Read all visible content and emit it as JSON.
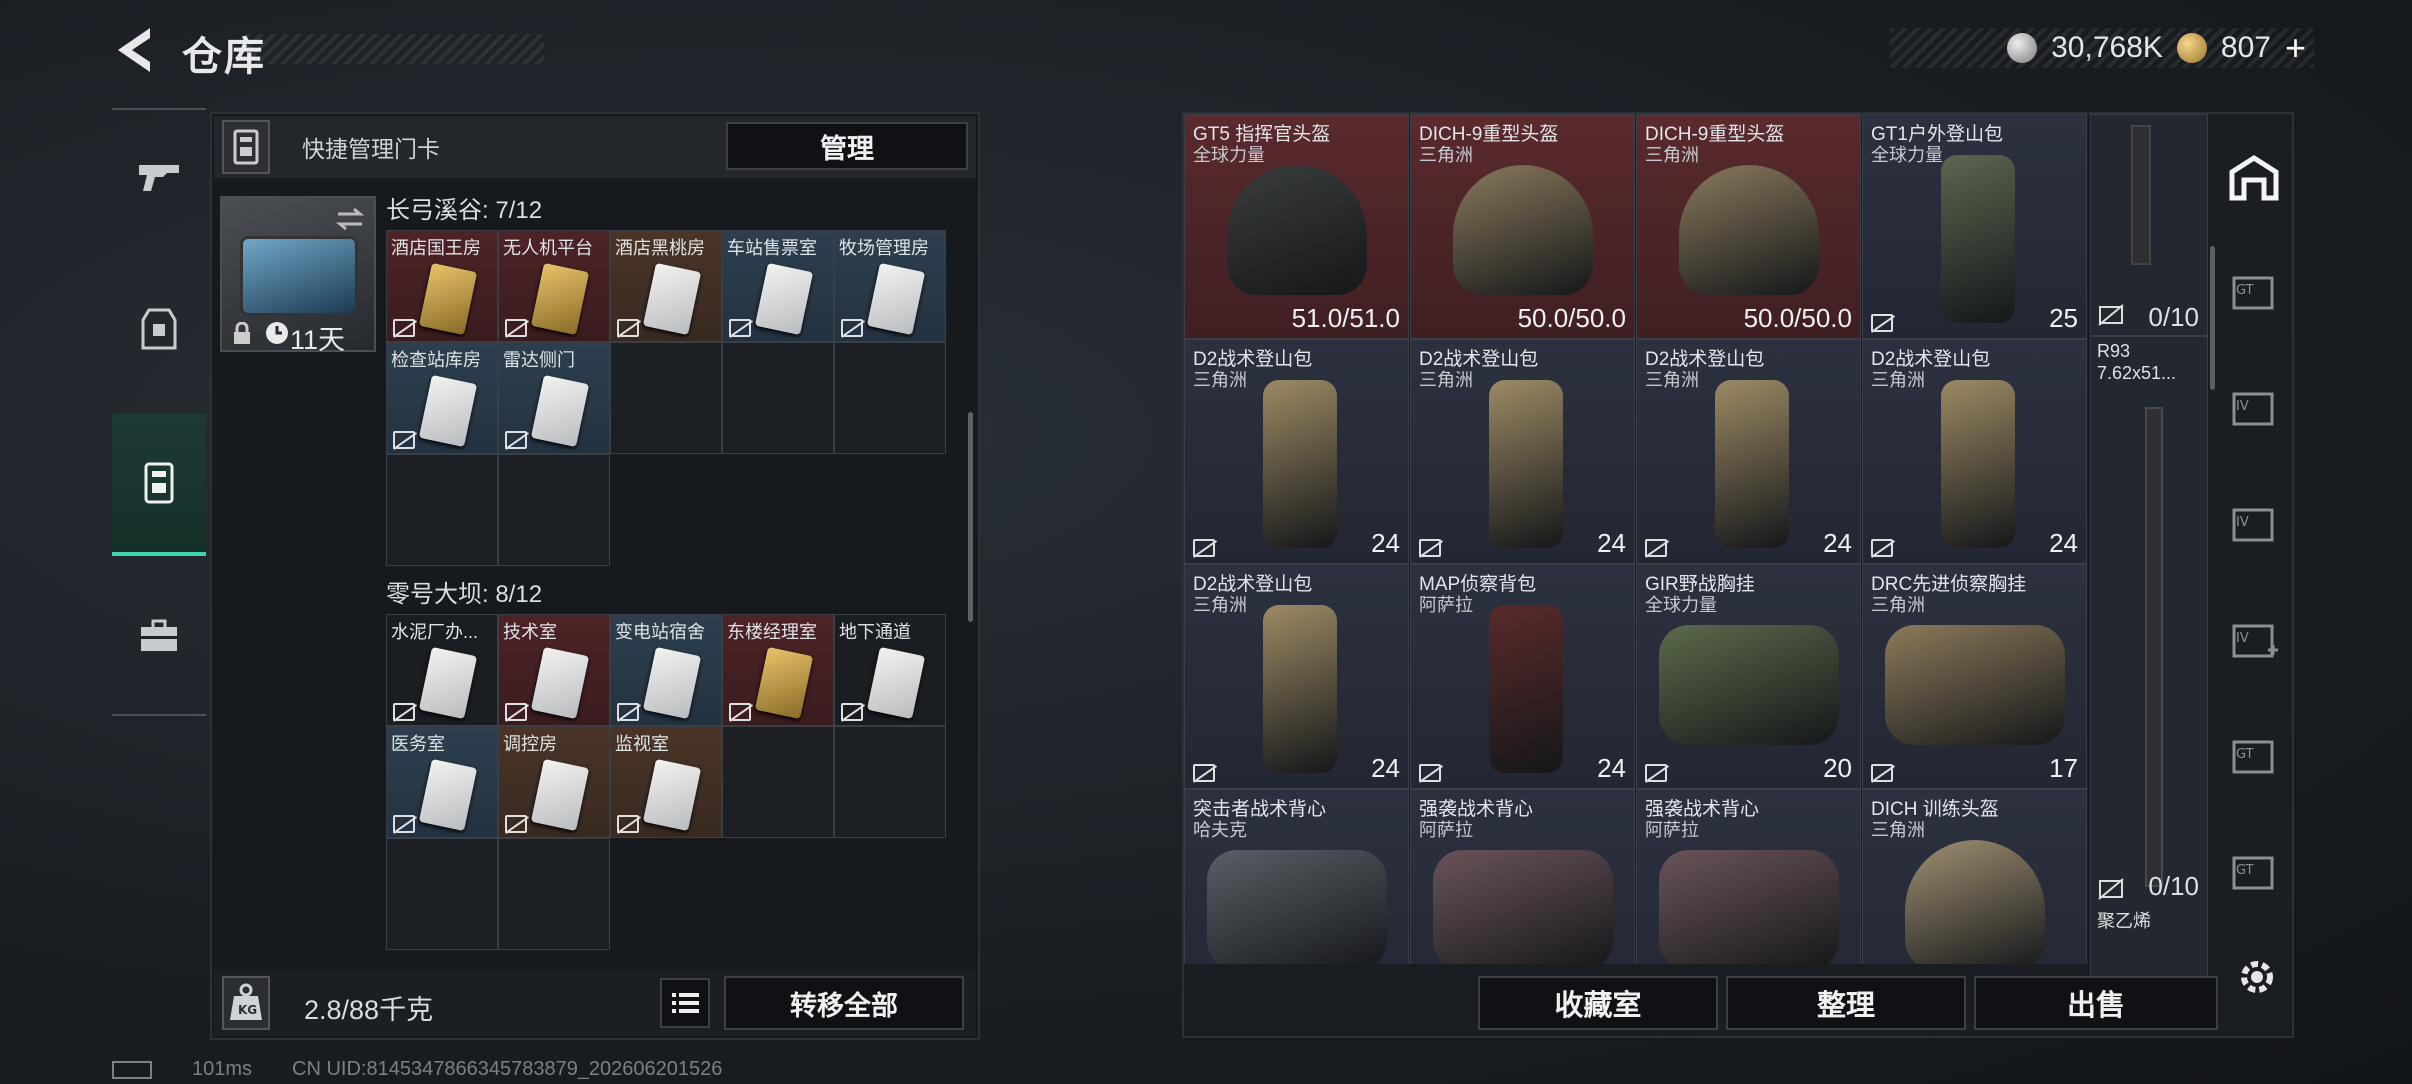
{
  "header": {
    "title": "仓库"
  },
  "currency": {
    "coins": "30,768K",
    "tokens": "807",
    "plus": "+"
  },
  "card_panel": {
    "header_label": "快捷管理门卡",
    "manage_label": "管理",
    "holder_days": "11天",
    "sections": [
      {
        "title": "长弓溪谷: 7/12",
        "cards": [
          {
            "label": "酒店国王房",
            "tone": "red",
            "card": "gold"
          },
          {
            "label": "无人机平台",
            "tone": "red",
            "card": "gold"
          },
          {
            "label": "酒店黑桃房",
            "tone": "brown",
            "card": "white"
          },
          {
            "label": "车站售票室",
            "tone": "blue",
            "card": "white"
          },
          {
            "label": "牧场管理房",
            "tone": "blue",
            "card": "white"
          },
          {
            "label": "检查站库房",
            "tone": "blue",
            "card": "white"
          },
          {
            "label": "雷达侧门",
            "tone": "blue",
            "card": "white"
          }
        ]
      },
      {
        "title": "零号大坝: 8/12",
        "cards": [
          {
            "label": "水泥厂办...",
            "tone": "dark",
            "card": "white"
          },
          {
            "label": "技术室",
            "tone": "red",
            "card": "white"
          },
          {
            "label": "变电站宿舍",
            "tone": "blue",
            "card": "white"
          },
          {
            "label": "东楼经理室",
            "tone": "red",
            "card": "gold"
          },
          {
            "label": "地下通道",
            "tone": "dark",
            "card": "white"
          },
          {
            "label": "医务室",
            "tone": "blue",
            "card": "white"
          },
          {
            "label": "调控房",
            "tone": "brown",
            "card": "white"
          },
          {
            "label": "监视室",
            "tone": "brown",
            "card": "white"
          }
        ]
      }
    ],
    "weight": "2.8/88千克",
    "transfer_all_label": "转移全部"
  },
  "inventory": {
    "items": [
      {
        "name": "GT5 指挥官头盔",
        "sub": "全球力量",
        "value": "51.0/51.0",
        "tone": "red",
        "shape": "helmet",
        "color": "#3a3d3c"
      },
      {
        "name": "DICH-9重型头盔",
        "sub": "三角洲",
        "value": "50.0/50.0",
        "tone": "red",
        "shape": "helmet",
        "color": "#8a7a5c"
      },
      {
        "name": "DICH-9重型头盔",
        "sub": "三角洲",
        "value": "50.0/50.0",
        "tone": "red",
        "shape": "helmet",
        "color": "#8a7a5c"
      },
      {
        "name": "GT1户外登山包",
        "sub": "全球力量",
        "value": "25",
        "tone": "slate",
        "shape": "pack",
        "color": "#5b6650"
      },
      {
        "name": "D2战术登山包",
        "sub": "三角洲",
        "value": "24",
        "tone": "slate",
        "shape": "pack",
        "color": "#9c8a64"
      },
      {
        "name": "D2战术登山包",
        "sub": "三角洲",
        "value": "24",
        "tone": "slate",
        "shape": "pack",
        "color": "#9c8a64"
      },
      {
        "name": "D2战术登山包",
        "sub": "三角洲",
        "value": "24",
        "tone": "slate",
        "shape": "pack",
        "color": "#9c8a64"
      },
      {
        "name": "D2战术登山包",
        "sub": "三角洲",
        "value": "24",
        "tone": "slate",
        "shape": "pack",
        "color": "#9c8a64"
      },
      {
        "name": "D2战术登山包",
        "sub": "三角洲",
        "value": "24",
        "tone": "slate",
        "shape": "pack",
        "color": "#9c8a64"
      },
      {
        "name": "MAP侦察背包",
        "sub": "阿萨拉",
        "value": "24",
        "tone": "slate",
        "shape": "pack",
        "color": "#5a2a2a"
      },
      {
        "name": "GIR野战胸挂",
        "sub": "全球力量",
        "value": "20",
        "tone": "slate",
        "shape": "vest",
        "color": "#5c6a4a"
      },
      {
        "name": "DRC先进侦察胸挂",
        "sub": "三角洲",
        "value": "17",
        "tone": "slate",
        "shape": "vest",
        "color": "#8c7a5a"
      },
      {
        "name": "突击者战术背心",
        "sub": "哈夫克",
        "value": "",
        "tone": "slate",
        "shape": "vest",
        "color": "#5a5f66"
      },
      {
        "name": "强袭战术背心",
        "sub": "阿萨拉",
        "value": "",
        "tone": "slate",
        "shape": "vest",
        "color": "#6a5458"
      },
      {
        "name": "强袭战术背心",
        "sub": "阿萨拉",
        "value": "",
        "tone": "slate",
        "shape": "vest",
        "color": "#6a5458"
      },
      {
        "name": "DICH 训练头盔",
        "sub": "三角洲",
        "value": "",
        "tone": "slate",
        "shape": "helmet",
        "color": "#a09072"
      }
    ],
    "gun_capacity_1": "0/10",
    "gun_name": "R93",
    "gun_ammo": "7.62x51...",
    "gun_capacity_2": "0/10",
    "gun_sub": "聚乙烯"
  },
  "actions": {
    "collection": "收藏室",
    "sort": "整理",
    "sell": "出售"
  },
  "status": {
    "ping": "101ms",
    "uid": "CN UID:8145347866345783879_202606201526"
  }
}
